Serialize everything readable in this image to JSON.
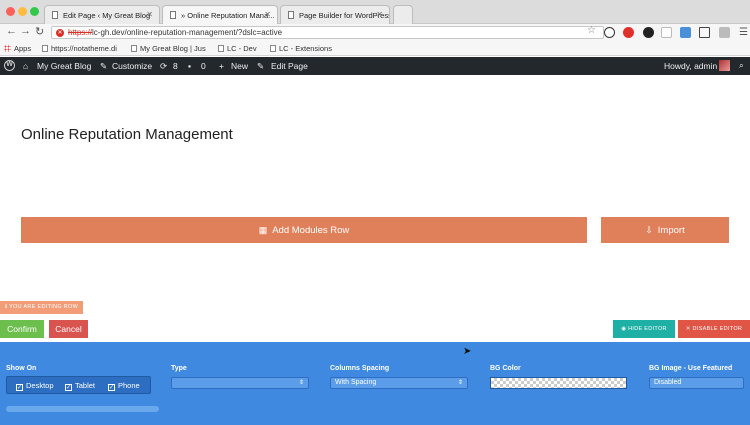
{
  "browser": {
    "tabs": [
      {
        "label": "Edit Page ‹ My Great Blog",
        "active": false
      },
      {
        "label": "» Online Reputation Mana...",
        "active": true
      },
      {
        "label": "Page Builder for WordPress",
        "active": false
      }
    ],
    "url_scheme": "https://",
    "url_rest": "lc-gh.dev/online-reputation-management/?dslc=active",
    "bookmarks": [
      "Apps",
      "https://notatheme.di",
      "My Great Blog | Jus",
      "LC - Dev",
      "LC - Extensions"
    ]
  },
  "wpbar": {
    "site": "My Great Blog",
    "customize": "Customize",
    "updates": "8",
    "comments": "0",
    "new": "New",
    "edit_page": "Edit Page",
    "howdy": "Howdy, admin"
  },
  "page": {
    "title": "Online Reputation Management",
    "add_row": "Add Modules Row",
    "import": "Import"
  },
  "editor": {
    "editing_tag": "YOU ARE EDITING ROW",
    "confirm": "Confirm",
    "cancel": "Cancel",
    "hide_editor": "HIDE EDITOR",
    "disable_editor": "DISABLE EDITOR",
    "show_on_label": "Show On",
    "show_on": [
      "Desktop",
      "Tablet",
      "Phone"
    ],
    "type_label": "Type",
    "type_value": "",
    "columns_label": "Columns Spacing",
    "columns_value": "With Spacing",
    "bgcolor_label": "BG Color",
    "bgimage_label": "BG Image - Use Featured",
    "bgimage_value": "Disabled"
  },
  "colors": {
    "accent_orange": "#e0805a",
    "panel_blue": "#3f8ae0",
    "confirm_green": "#6cbf4d",
    "cancel_red": "#d9534f",
    "hide_teal": "#1eb0a5"
  }
}
